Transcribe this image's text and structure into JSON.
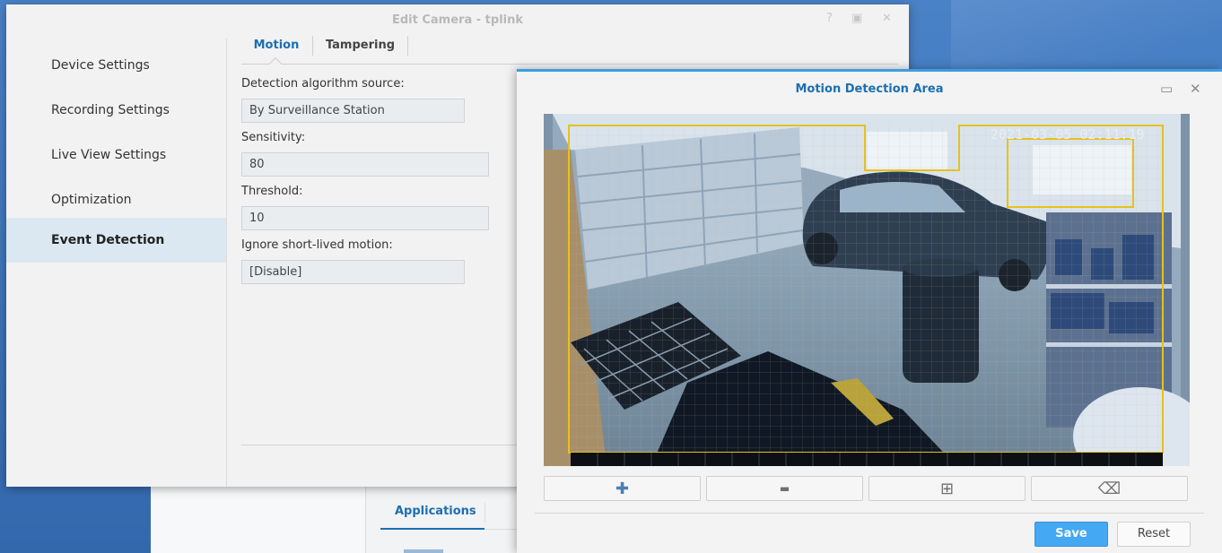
{
  "edit_window": {
    "title": "Edit Camera - tplink",
    "controls": {
      "help": "?",
      "maximize": "▣",
      "close": "✕"
    },
    "sidebar": {
      "items": [
        {
          "label": "Device Settings"
        },
        {
          "label": "Recording Settings"
        },
        {
          "label": "Live View Settings"
        },
        {
          "label": "Optimization"
        },
        {
          "label": "Event Detection",
          "active": true
        }
      ]
    },
    "tabs": [
      {
        "label": "Motion",
        "active": true
      },
      {
        "label": "Tampering"
      }
    ],
    "fields": {
      "algorithm_label": "Detection algorithm source:",
      "algorithm_value": "By Surveillance Station",
      "sensitivity_label": "Sensitivity:",
      "sensitivity_value": "80",
      "threshold_label": "Threshold:",
      "threshold_value": "10",
      "ignore_label": "Ignore short-lived motion:",
      "ignore_value": "[Disable]"
    }
  },
  "background_app": {
    "tab_label": "Applications"
  },
  "motion_window": {
    "title": "Motion Detection Area",
    "controls": {
      "maximize": "▭",
      "close": "✕"
    },
    "camera_timestamp": "2021-03-05 02:11:19",
    "tools": [
      {
        "icon": "plus-icon",
        "glyph": "✚"
      },
      {
        "icon": "minus-icon",
        "glyph": "▬"
      },
      {
        "icon": "add-region-icon",
        "glyph": "⊞"
      },
      {
        "icon": "eraser-icon",
        "glyph": "⌫"
      }
    ],
    "save_label": "Save",
    "reset_label": "Reset"
  },
  "colors": {
    "accent": "#1c6fb0",
    "save_button": "#45a8f2",
    "region_outline": "#e8c11a",
    "active_sidebar": "#dce8f1"
  }
}
